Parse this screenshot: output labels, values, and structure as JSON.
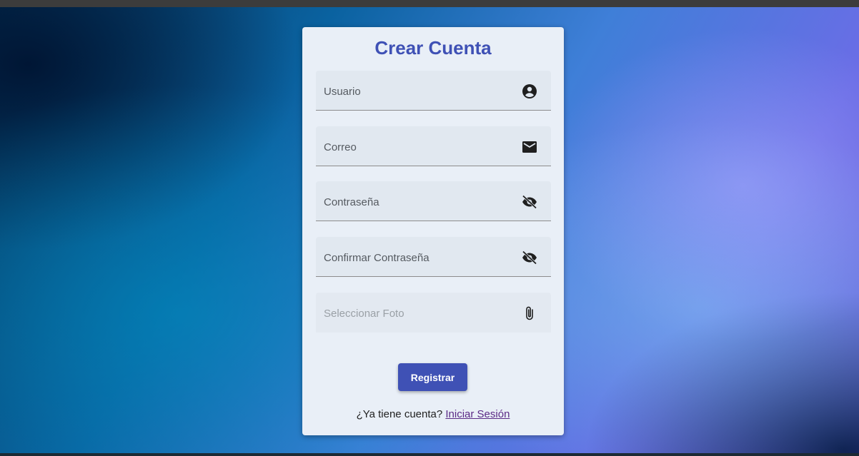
{
  "form": {
    "title": "Crear Cuenta",
    "fields": [
      {
        "label": "Usuario",
        "icon": "account-circle-icon"
      },
      {
        "label": "Correo",
        "icon": "mail-icon"
      },
      {
        "label": "Contraseña",
        "icon": "visibility-off-icon"
      },
      {
        "label": "Confirmar Contraseña",
        "icon": "visibility-off-icon"
      },
      {
        "label": "Seleccionar Foto",
        "icon": "paperclip-icon"
      }
    ],
    "submit_label": "Registrar",
    "footer_text": "¿Ya tiene cuenta?",
    "login_link": "Iniciar Sesión"
  },
  "colors": {
    "accent": "#3f51b5",
    "card_background": "#e9eff7",
    "link": "#5b2a86"
  }
}
